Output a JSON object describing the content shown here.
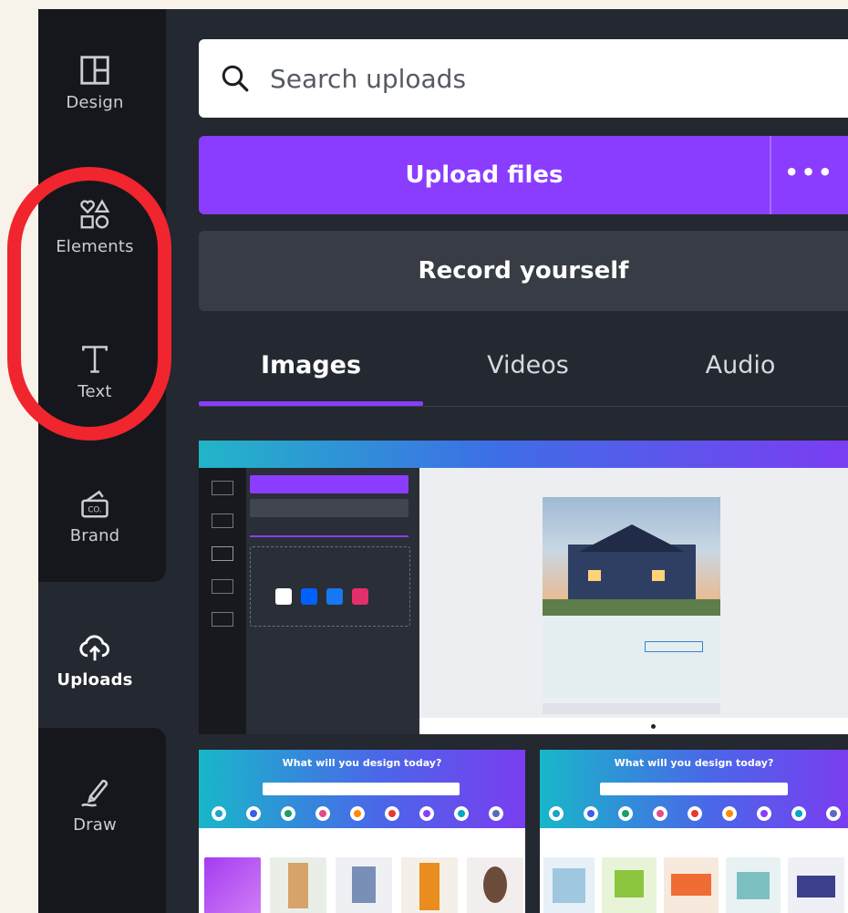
{
  "sidebar": {
    "items": [
      {
        "label": "Design",
        "icon": "layout-icon"
      },
      {
        "label": "Elements",
        "icon": "shapes-icon"
      },
      {
        "label": "Text",
        "icon": "text-t-icon"
      },
      {
        "label": "Brand",
        "icon": "brand-kit-icon"
      },
      {
        "label": "Uploads",
        "icon": "cloud-upload-icon",
        "active": true
      },
      {
        "label": "Draw",
        "icon": "pen-icon"
      }
    ]
  },
  "search": {
    "placeholder": "Search uploads",
    "icon": "search-icon"
  },
  "upload_button": {
    "label": "Upload files",
    "more_label": "•••"
  },
  "record_button": {
    "label": "Record yourself"
  },
  "tabs": [
    {
      "label": "Images",
      "active": true
    },
    {
      "label": "Videos",
      "active": false
    },
    {
      "label": "Audio",
      "active": false
    }
  ],
  "thumbnails": [
    {
      "kind": "editor-screenshot"
    },
    {
      "kind": "homepage-screenshot",
      "title": "What will you design today?"
    },
    {
      "kind": "homepage-screenshot",
      "title": "What will you design today?"
    }
  ],
  "colors": {
    "accent": "#8b3dff",
    "annotation": "#f0252e",
    "panel_bg": "#242830",
    "rail_bg": "#15171c"
  }
}
